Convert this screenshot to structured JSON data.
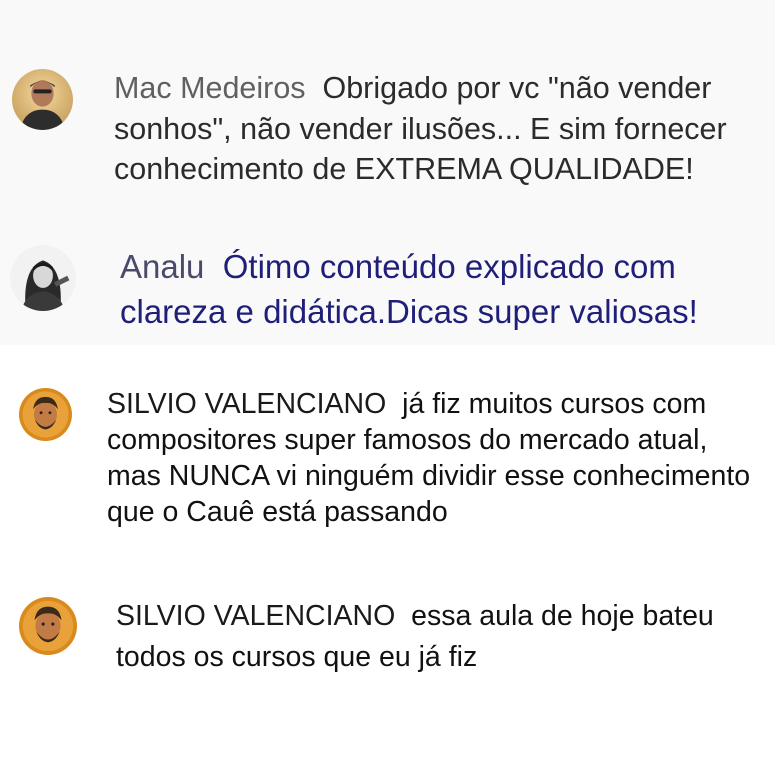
{
  "comments": [
    {
      "author": "Mac Medeiros",
      "avatar_icon": "user-avatar-icon",
      "lines": [
        "Obrigado por vc \"não vender",
        "sonhos\", não vender ilusões... E sim fornecer",
        "conhecimento de EXTREMA QUALIDADE!"
      ]
    },
    {
      "author": "Analu",
      "avatar_icon": "user-avatar-icon",
      "lines": [
        "Ótimo conteúdo explicado com",
        "clareza e didática.Dicas super valiosas!"
      ]
    },
    {
      "author": "SILVIO VALENCIANO",
      "avatar_icon": "user-avatar-icon",
      "lines": [
        "já fiz muitos cursos com",
        "compositores super famosos do mercado atual,",
        "mas NUNCA vi ninguém dividir esse conhecimento",
        "que o Cauê está passando"
      ]
    },
    {
      "author": "SILVIO VALENCIANO",
      "avatar_icon": "user-avatar-icon",
      "lines": [
        "essa aula de hoje bateu",
        "todos os cursos que eu já fiz"
      ]
    }
  ]
}
